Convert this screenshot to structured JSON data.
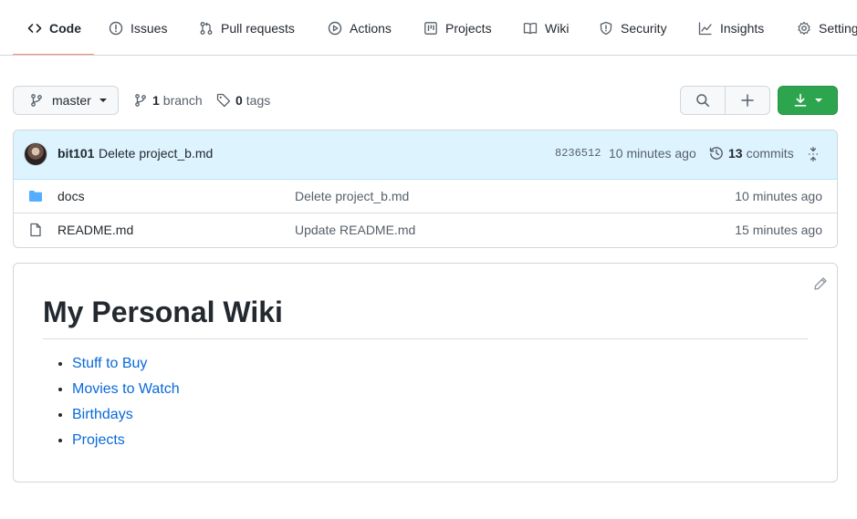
{
  "nav": {
    "tabs": [
      {
        "label": "Code",
        "icon": "code-icon",
        "selected": true
      },
      {
        "label": "Issues",
        "icon": "issue-icon"
      },
      {
        "label": "Pull requests",
        "icon": "pull-request-icon"
      },
      {
        "label": "Actions",
        "icon": "play-icon"
      },
      {
        "label": "Projects",
        "icon": "project-icon"
      },
      {
        "label": "Wiki",
        "icon": "book-icon"
      },
      {
        "label": "Security",
        "icon": "shield-icon"
      },
      {
        "label": "Insights",
        "icon": "graph-icon"
      },
      {
        "label": "Settings",
        "icon": "gear-icon"
      }
    ],
    "selected_underline_color": "#fd8c73"
  },
  "toolbar": {
    "branch": "master",
    "branch_count": "1",
    "branch_label": "branch",
    "tag_count": "0",
    "tag_label": "tags",
    "go_to_file_icon": "search-icon",
    "add_file_icon": "plus-icon",
    "code_button_icon": "download-icon",
    "code_button_color": "#2da44e"
  },
  "commit": {
    "author": "bit101",
    "message": "Delete project_b.md",
    "sha": "8236512",
    "time": "10 minutes ago",
    "commit_count": "13",
    "commits_label": "commits"
  },
  "files": [
    {
      "name": "docs",
      "type": "folder",
      "message": "Delete project_b.md",
      "age": "10 minutes ago"
    },
    {
      "name": "README.md",
      "type": "file",
      "message": "Update README.md",
      "age": "15 minutes ago"
    }
  ],
  "readme": {
    "title": "My Personal Wiki",
    "links": [
      "Stuff to Buy",
      "Movies to Watch",
      "Birthdays",
      "Projects"
    ],
    "link_color": "#0969da"
  }
}
